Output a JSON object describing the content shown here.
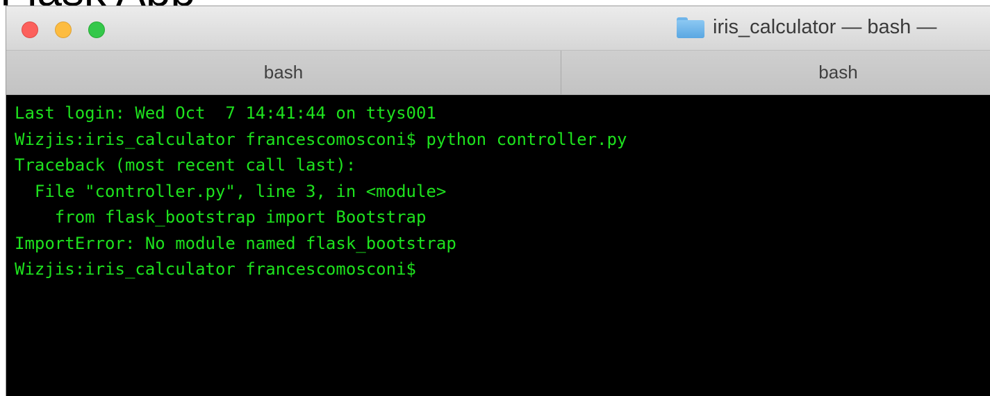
{
  "background": {
    "heading": "Flask App"
  },
  "window": {
    "title": "iris_calculator — bash —",
    "title_icon": "folder-icon",
    "traffic_lights": {
      "close_color": "#fc605c",
      "minimize_color": "#fdbc40",
      "maximize_color": "#34c84a"
    }
  },
  "tabs": [
    {
      "label": "bash"
    },
    {
      "label": "bash"
    }
  ],
  "terminal": {
    "text_color": "#1ee21e",
    "background_color": "#000000",
    "lines": [
      "Last login: Wed Oct  7 14:41:44 on ttys001",
      "Wizjis:iris_calculator francescomosconi$ python controller.py",
      "Traceback (most recent call last):",
      "  File \"controller.py\", line 3, in <module>",
      "    from flask_bootstrap import Bootstrap",
      "ImportError: No module named flask_bootstrap",
      "Wizjis:iris_calculator francescomosconi$"
    ]
  }
}
